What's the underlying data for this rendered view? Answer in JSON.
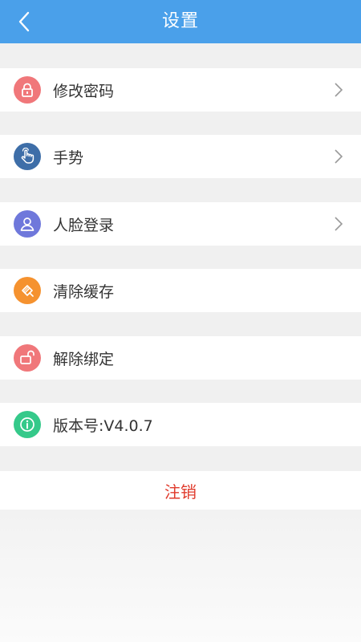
{
  "header": {
    "title": "设置",
    "back_icon": "chevron-left-icon"
  },
  "settings": [
    {
      "label": "修改密码",
      "icon": "lock-icon",
      "icon_color": "#f0777a",
      "has_chevron": true
    },
    {
      "label": "手势",
      "icon": "hand-gesture-icon",
      "icon_color": "#3e6ea8",
      "has_chevron": true
    },
    {
      "label": "人脸登录",
      "icon": "face-user-icon",
      "icon_color": "#6f78db",
      "has_chevron": true
    },
    {
      "label": "清除缓存",
      "icon": "broom-icon",
      "icon_color": "#f5922f",
      "has_chevron": false
    },
    {
      "label": "解除绑定",
      "icon": "unlock-icon",
      "icon_color": "#f0777a",
      "has_chevron": false
    },
    {
      "label": "版本号:V4.0.7",
      "icon": "info-icon",
      "icon_color": "#35c98a",
      "has_chevron": false
    }
  ],
  "logout_label": "注销",
  "colors": {
    "header_bg": "#4aa0ea",
    "page_bg": "#f0f0f0",
    "logout_text": "#e03a2b"
  }
}
